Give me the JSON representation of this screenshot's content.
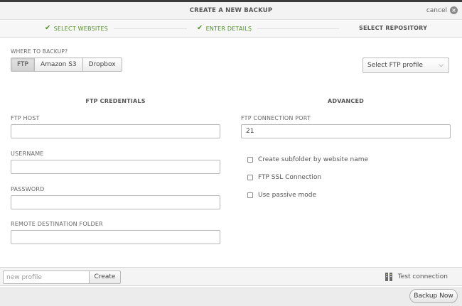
{
  "header": {
    "title": "CREATE A NEW BACKUP",
    "cancel_label": "cancel"
  },
  "steps": [
    {
      "label": "SELECT WEBSITES",
      "state": "done"
    },
    {
      "label": "ENTER DETAILS",
      "state": "done"
    },
    {
      "label": "SELECT REPOSITORY",
      "state": "active"
    }
  ],
  "where": {
    "label": "WHERE TO BACKUP?",
    "options": [
      "FTP",
      "Amazon S3",
      "Dropbox"
    ],
    "selected": "FTP"
  },
  "profile_select": {
    "value": "Select FTP profile"
  },
  "ftp": {
    "title": "FTP CREDENTIALS",
    "host_label": "FTP HOST",
    "host_value": "",
    "username_label": "USERNAME",
    "username_value": "",
    "password_label": "PASSWORD",
    "password_value": "",
    "folder_label": "REMOTE DESTINATION FOLDER",
    "folder_value": ""
  },
  "advanced": {
    "title": "ADVANCED",
    "port_label": "FTP CONNECTION PORT",
    "port_value": "21",
    "options": [
      {
        "label": "Create subfolder by website name",
        "checked": false
      },
      {
        "label": "FTP SSL Connection",
        "checked": false
      },
      {
        "label": "Use passive mode",
        "checked": false
      }
    ]
  },
  "footer": {
    "profile_placeholder": "new profile",
    "create_label": "Create",
    "test_label": "Test connection"
  },
  "actions": {
    "backup_label": "Backup Now"
  },
  "colors": {
    "done_green": "#4f8f2a",
    "header_bg": "#f3f3f3"
  }
}
